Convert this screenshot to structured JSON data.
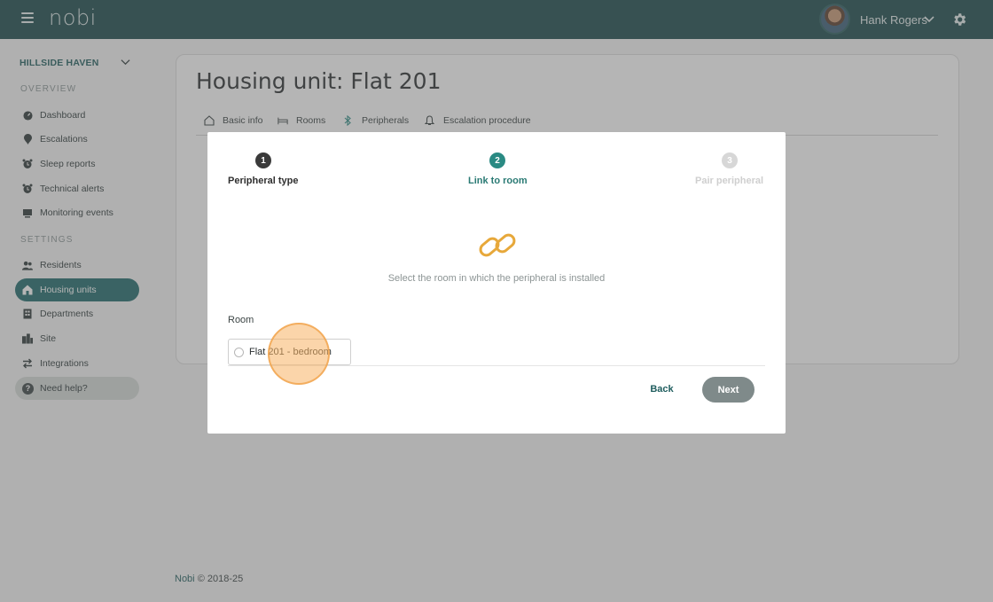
{
  "topbar": {
    "logo": "nobi",
    "user_name": "Hank Rogers"
  },
  "sidebar": {
    "organization": "HILLSIDE HAVEN",
    "overview_heading": "OVERVIEW",
    "settings_heading": "SETTINGS",
    "overview_items": [
      {
        "label": "Dashboard",
        "icon": "dashboard-icon"
      },
      {
        "label": "Escalations",
        "icon": "alert-pin-icon"
      },
      {
        "label": "Sleep reports",
        "icon": "alarm-clock-icon"
      },
      {
        "label": "Technical alerts",
        "icon": "alarm-clock-icon"
      },
      {
        "label": "Monitoring events",
        "icon": "monitor-icon"
      }
    ],
    "settings_items": [
      {
        "label": "Residents",
        "icon": "people-icon"
      },
      {
        "label": "Housing units",
        "icon": "house-icon",
        "active": true
      },
      {
        "label": "Departments",
        "icon": "building-icon"
      },
      {
        "label": "Site",
        "icon": "city-icon"
      },
      {
        "label": "Integrations",
        "icon": "swap-arrows-icon"
      }
    ],
    "help_label": "Need help?"
  },
  "page": {
    "title": "Housing unit: Flat 201",
    "tabs": [
      {
        "label": "Basic info",
        "icon": "house-outline-icon"
      },
      {
        "label": "Rooms",
        "icon": "bed-icon"
      },
      {
        "label": "Peripherals",
        "icon": "bluetooth-icon"
      },
      {
        "label": "Escalation procedure",
        "icon": "bell-icon"
      }
    ]
  },
  "modal": {
    "steps": [
      {
        "number": "1",
        "label": "Peripheral type",
        "state": "done"
      },
      {
        "number": "2",
        "label": "Link to room",
        "state": "current"
      },
      {
        "number": "3",
        "label": "Pair peripheral",
        "state": "upcoming"
      }
    ],
    "instruction": "Select the room in which the peripheral is installed",
    "room_label": "Room",
    "room_option": "Flat 201 - bedroom",
    "back_label": "Back",
    "next_label": "Next"
  },
  "footer": {
    "brand": "Nobi",
    "copyright": "© 2018-25"
  },
  "colors": {
    "topbar": "#1b4a4b",
    "accent": "#1f6b6c",
    "step_current": "#2a8a83",
    "step_done": "#3a3a3a",
    "link_icon": "#e7a83a",
    "next_button": "#7f8a8a"
  }
}
